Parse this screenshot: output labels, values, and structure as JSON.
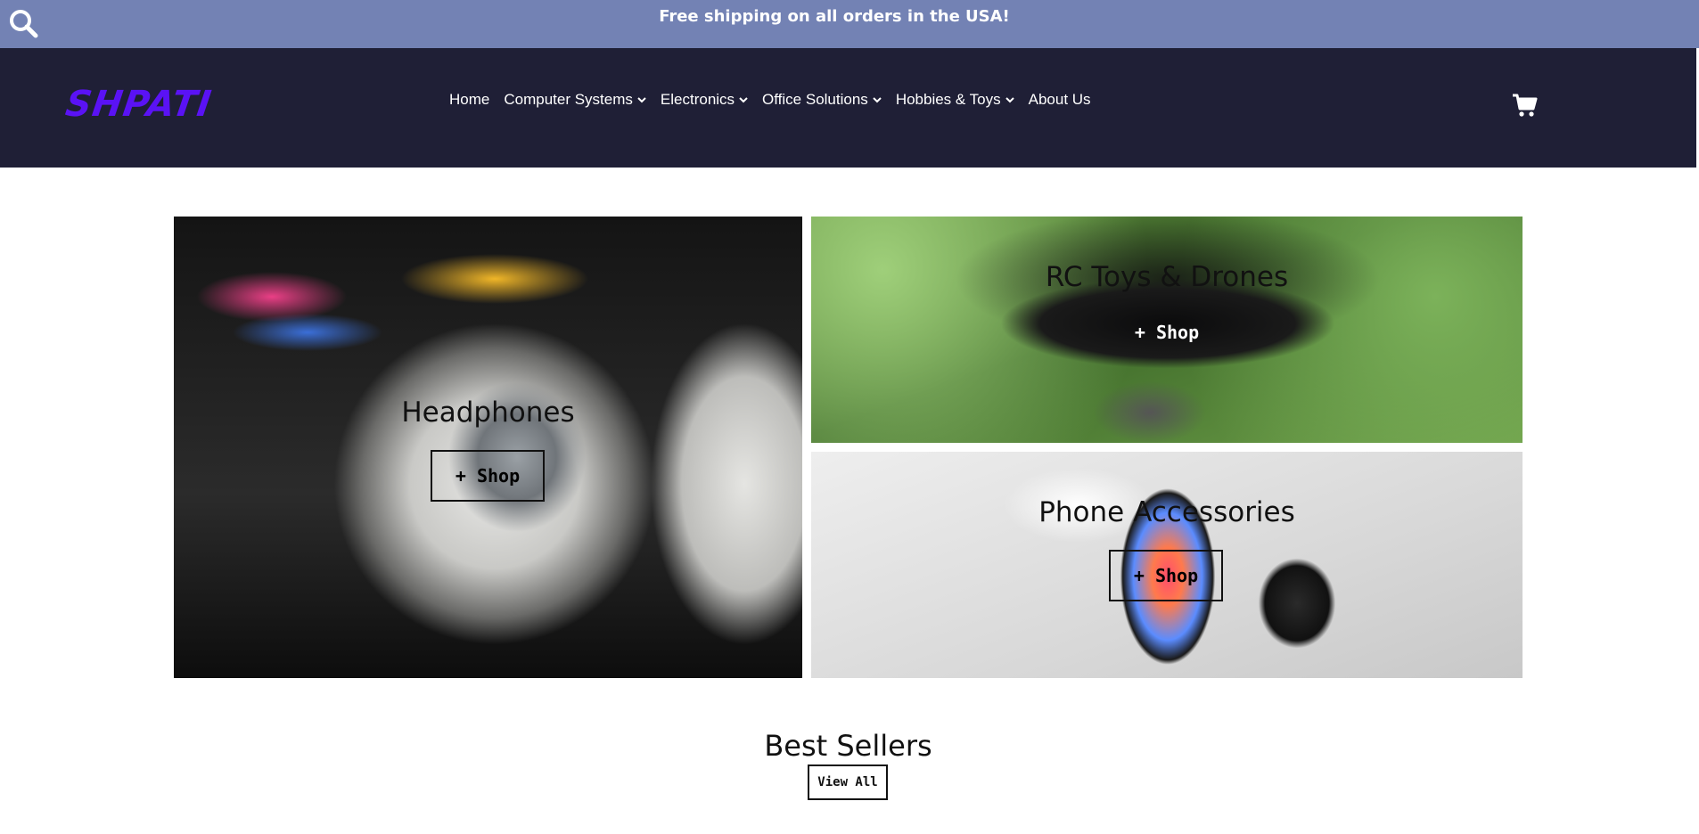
{
  "announcement": {
    "text": "Free shipping on all orders in the USA!"
  },
  "header": {
    "logo": "SHPATI",
    "nav": [
      {
        "label": "Home",
        "dropdown": false
      },
      {
        "label": "Computer Systems",
        "dropdown": true
      },
      {
        "label": "Electronics",
        "dropdown": true
      },
      {
        "label": "Office Solutions",
        "dropdown": true
      },
      {
        "label": "Hobbies & Toys",
        "dropdown": true
      },
      {
        "label": "About Us",
        "dropdown": false
      }
    ]
  },
  "tiles": {
    "headphones": {
      "title": "Headphones",
      "button": "+ Shop"
    },
    "drones": {
      "title": "RC Toys & Drones",
      "button": "+ Shop"
    },
    "phone": {
      "title": "Phone Accessories",
      "button": "+ Shop"
    }
  },
  "best_sellers": {
    "title": "Best Sellers",
    "button": "View All"
  },
  "colors": {
    "announce_bg": "#7382b4",
    "header_bg": "#1f1f36",
    "logo": "#5a12f5"
  },
  "icons": {
    "search": "search-icon",
    "cart": "cart-icon",
    "dropdown": "chevron-down-icon"
  }
}
